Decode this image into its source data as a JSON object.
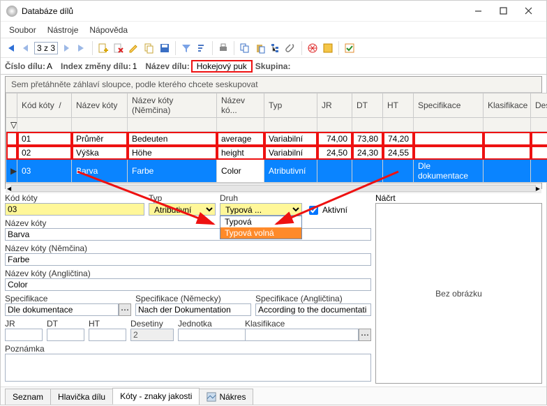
{
  "title": "Databáze dílů",
  "menu": [
    "Soubor",
    "Nástroje",
    "Nápověda"
  ],
  "pager": "3 z 3",
  "info": {
    "part_no_label": "Číslo dílu:",
    "part_no": "A",
    "chg_idx_label": "Index změny dílu:",
    "chg_idx": "1",
    "part_name_label": "Název dílu:",
    "part_name": "Hokejový puk",
    "group_label": "Skupina:"
  },
  "grid": {
    "group_hint": "Sem přetáhněte záhlaví sloupce, podle kterého chcete seskupovat",
    "cols": [
      "Kód kóty",
      "Název kóty",
      "Název kóty (Němčina)",
      "Název kó...",
      "Typ",
      "JR",
      "DT",
      "HT",
      "Specifikace",
      "Klasifikace",
      "Dese"
    ],
    "rows": [
      {
        "code": "01",
        "name": "Průměr",
        "de": "Bedeuten",
        "en": "average",
        "typ": "Variabilní",
        "jr": "74,00",
        "dt": "73,80",
        "ht": "74,20",
        "spec": "",
        "klas": ""
      },
      {
        "code": "02",
        "name": "Výška",
        "de": "Höhe",
        "en": "height",
        "typ": "Variabilní",
        "jr": "24,50",
        "dt": "24,30",
        "ht": "24,55",
        "spec": "",
        "klas": ""
      },
      {
        "code": "03",
        "name": "Barva",
        "de": "Farbe",
        "en": "Color",
        "typ": "Atributivní",
        "jr": "",
        "dt": "",
        "ht": "",
        "spec": "Dle dokumentace",
        "klas": ""
      }
    ]
  },
  "form": {
    "kod_label": "Kód kóty",
    "kod": "03",
    "typ_label": "Typ",
    "typ": "Atributivní",
    "druh_label": "Druh",
    "druh": "Typová ...",
    "druh_options": [
      "Typová",
      "Typová volná"
    ],
    "aktivni_label": "Aktivní",
    "nazev_label": "Název kóty",
    "nazev": "Barva",
    "nazev_de_label": "Název kóty (Němčina)",
    "nazev_de": "Farbe",
    "nazev_en_label": "Název kóty (Angličtina)",
    "nazev_en": "Color",
    "spec_label": "Specifikace",
    "spec": "Dle dokumentace",
    "spec_de_label": "Specifikace (Německy)",
    "spec_de": "Nach der Dokumentation",
    "spec_en_label": "Specifikace (Angličtina)",
    "spec_en": "According to the documentati",
    "jr_label": "JR",
    "dt_label": "DT",
    "ht_label": "HT",
    "des_label": "Desetiny",
    "des": "2",
    "jed_label": "Jednotka",
    "klas_label": "Klasifikace",
    "poznamka_label": "Poznámka",
    "sketch_label": "Náčrt",
    "sketch_empty": "Bez obrázku"
  },
  "tabs": [
    "Seznam",
    "Hlavička dílu",
    "Kóty - znaky jakosti",
    "Nákres"
  ]
}
